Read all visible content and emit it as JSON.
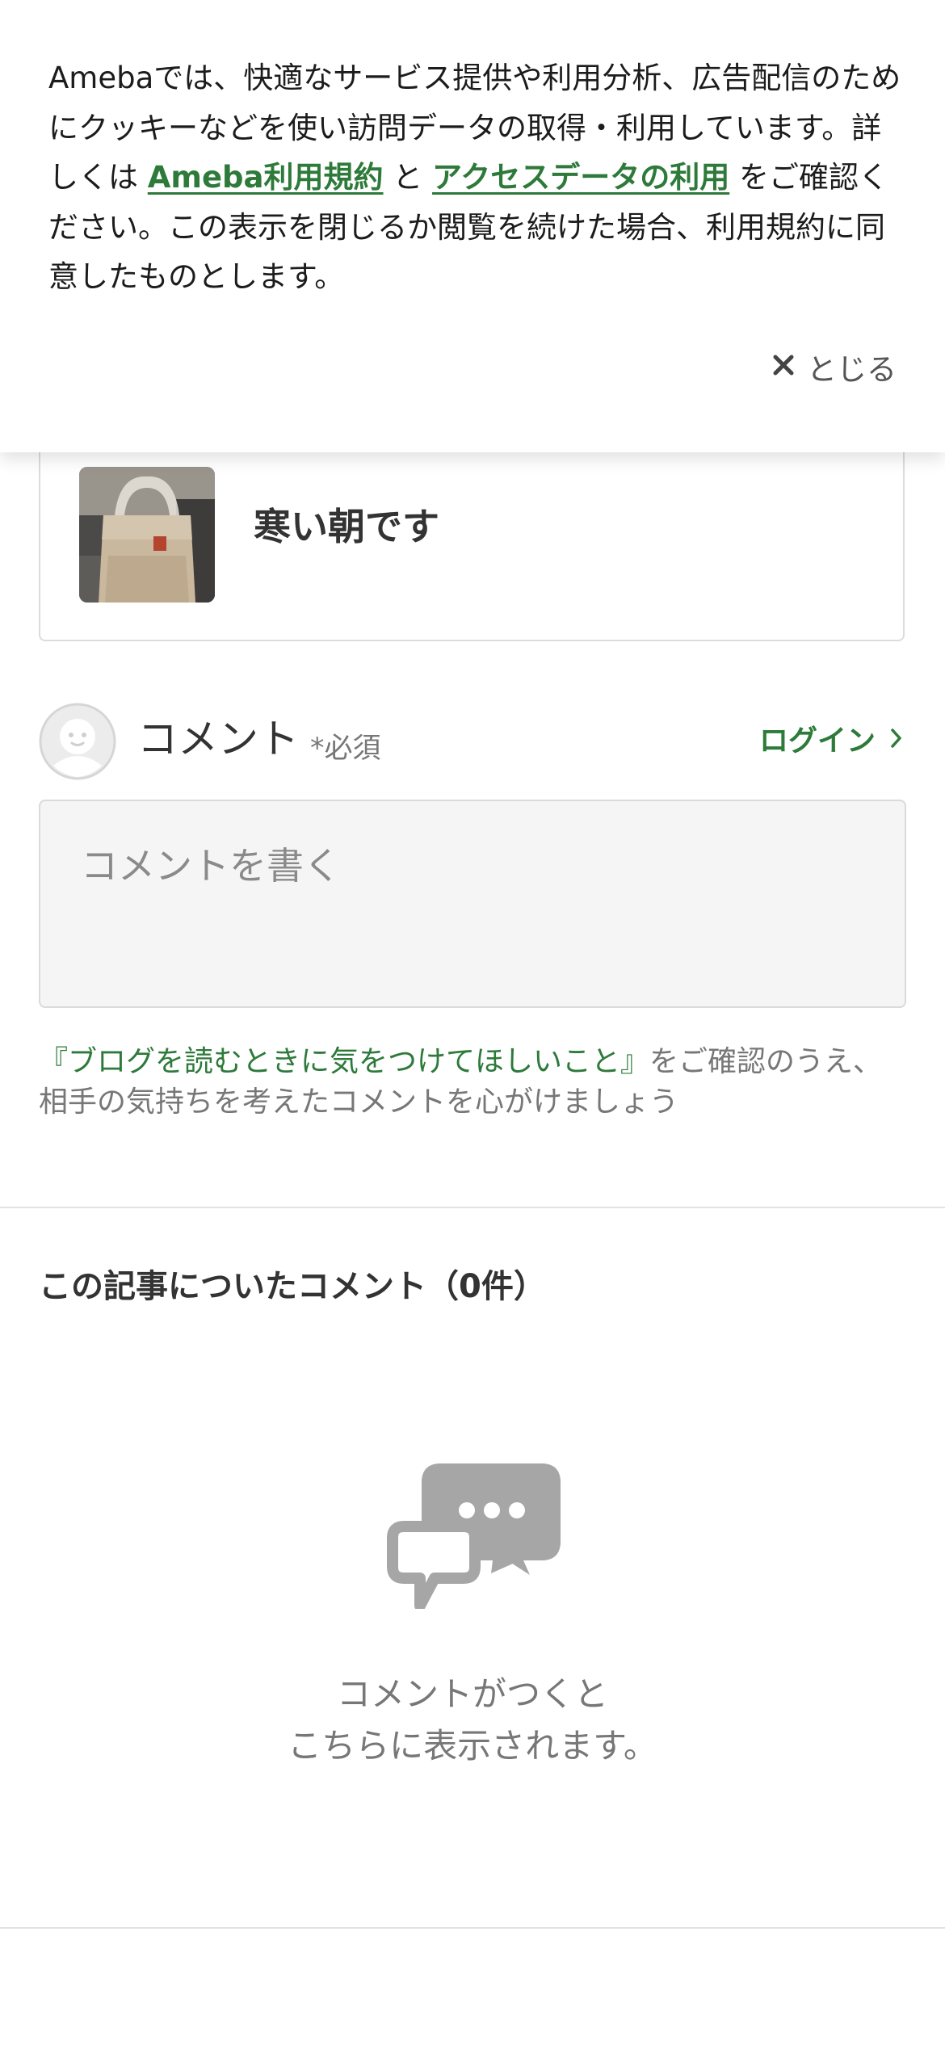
{
  "cookie_banner": {
    "text_before_link1": "Amebaでは、快適なサービス提供や利用分析、広告配信のためにクッキーなどを使い訪問データの取得・利用しています。詳しくは ",
    "link1": "Ameba利用規約",
    "text_between": " と ",
    "link2": "アクセスデータの利用",
    "text_after": " をご確認ください。この表示を閉じるか閲覧を続けた場合、利用規約に同意したものとします。",
    "close_label": "とじる",
    "close_icon": "close-icon"
  },
  "article": {
    "title": "寒い朝です",
    "thumbnail": "shopping-bag-photo"
  },
  "comment_form": {
    "label": "コメント",
    "required": "*必須",
    "login_label": "ログイン",
    "placeholder": "コメントを書く",
    "note_link": "『ブログを読むときに気をつけてほしいこと』",
    "note_text": "をご確認のうえ、相手の気持ちを考えたコメントを心がけましょう"
  },
  "comments_section": {
    "heading": "この記事についたコメント（0件）",
    "empty_line1": "コメントがつくと",
    "empty_line2": "こちらに表示されます。"
  },
  "colors": {
    "accent_green": "#2d7a3a",
    "icon_gray": "#a6a6a6",
    "text_main": "#333333",
    "text_sub": "#777777"
  }
}
